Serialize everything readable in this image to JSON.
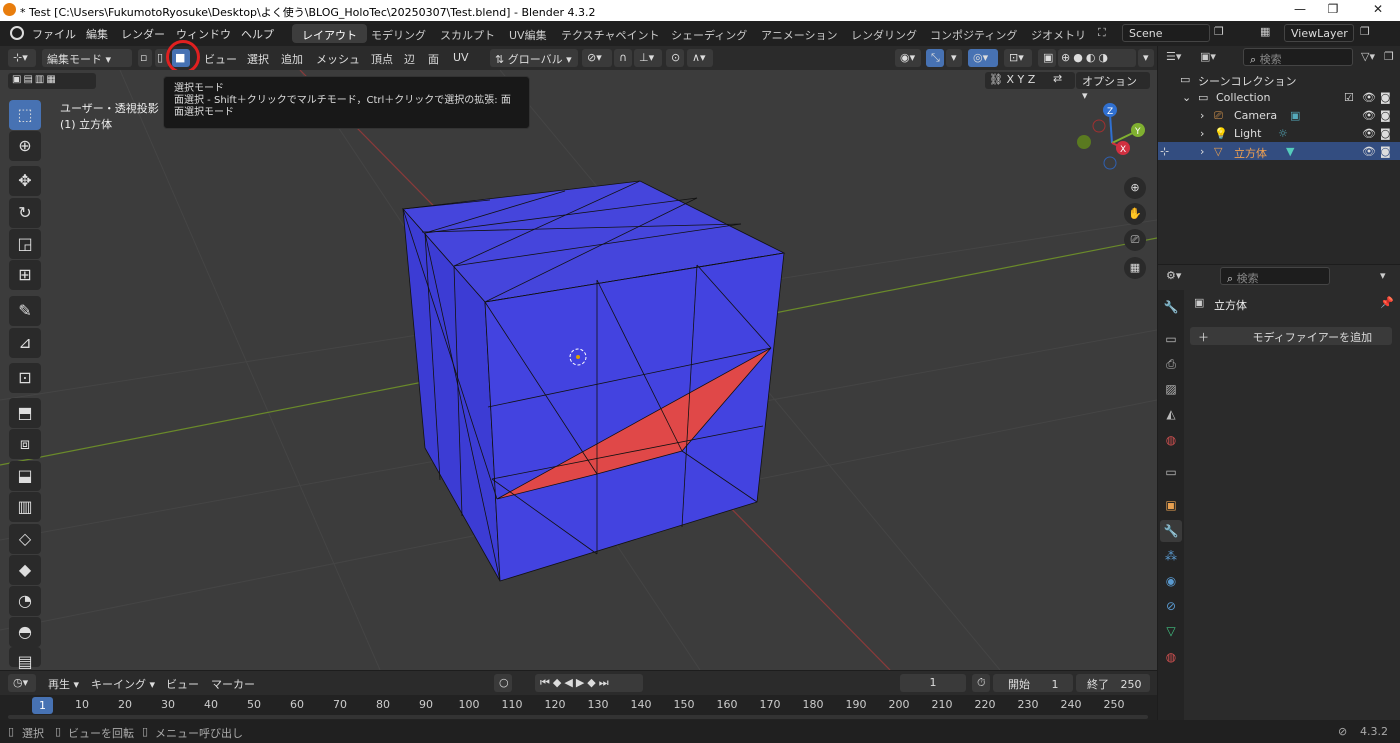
{
  "window": {
    "title": "* Test [C:\\Users\\FukumotoRyosuke\\Desktop\\よく使う\\BLOG_HoloTec\\20250307\\Test.blend] - Blender 4.3.2",
    "min": "—",
    "max": "❐",
    "close": "✕"
  },
  "menu": [
    "ファイル",
    "編集",
    "レンダー",
    "ウィンドウ",
    "ヘルプ"
  ],
  "workspaces": [
    "レイアウト",
    "モデリング",
    "スカルプト",
    "UV編集",
    "テクスチャペイント",
    "シェーディング",
    "アニメーション",
    "レンダリング",
    "コンポジティング",
    "ジオメトリ"
  ],
  "scene": "Scene",
  "viewlayer": "ViewLayer",
  "header": {
    "mode": "編集モード",
    "items": [
      "ビュー",
      "選択",
      "追加",
      "メッシュ",
      "頂点",
      "辺",
      "面",
      "UV"
    ],
    "transform": "グローバル",
    "axes": [
      "X",
      "Y",
      "Z"
    ],
    "options": "オプション"
  },
  "viewport": {
    "view_name": "ユーザー・透視投影",
    "object_name": "(1) 立方体"
  },
  "tooltip": {
    "title": "選択モード",
    "line1": "面選択 - Shift＋クリックでマルチモード，Ctrl＋クリックで選択の拡張: 面",
    "line2": "面選択モード"
  },
  "outliner": {
    "search": "検索",
    "root": "シーンコレクション",
    "collection": "Collection",
    "items": [
      "Camera",
      "Light",
      "立方体"
    ]
  },
  "properties": {
    "search": "検索",
    "object": "立方体",
    "add_modifier": "モディファイアーを追加"
  },
  "timeline": {
    "playback": "再生",
    "keying": "キーイング",
    "view": "ビュー",
    "marker": "マーカー",
    "frame": "1",
    "start_label": "開始",
    "start": "1",
    "end_label": "終了",
    "end": "250",
    "ticks": [
      "10",
      "20",
      "30",
      "40",
      "50",
      "60",
      "70",
      "80",
      "90",
      "100",
      "110",
      "120",
      "130",
      "140",
      "150",
      "160",
      "170",
      "180",
      "190",
      "200",
      "210",
      "220",
      "230",
      "240",
      "250"
    ]
  },
  "status": {
    "select": "選択",
    "rotate": "ビューを回転",
    "menu": "メニュー呼び出し",
    "version": "4.3.2"
  },
  "colors": {
    "accent": "#4772b3",
    "cube_blue": "#4343e0",
    "face_red": "#e04848",
    "highlight_circle": "#e02020"
  }
}
